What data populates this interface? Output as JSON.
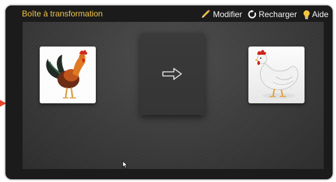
{
  "window": {
    "title": "Boîte à transformation"
  },
  "toolbar": {
    "modify_label": "Modifier",
    "reload_label": "Recharger",
    "help_label": "Aide"
  },
  "colors": {
    "title": "#f2c84b",
    "toolbar_text": "#f7f7f7",
    "window_frame": "#1b1b1b",
    "stage": "#3e3e3e",
    "outer_arrow": "#e8452c"
  },
  "icons": {
    "modify": "pencil-icon",
    "reload": "reload-icon",
    "help": "lightbulb-icon",
    "transform": "arrow-right-icon"
  },
  "cards": {
    "input": "rooster",
    "output": "hen"
  }
}
